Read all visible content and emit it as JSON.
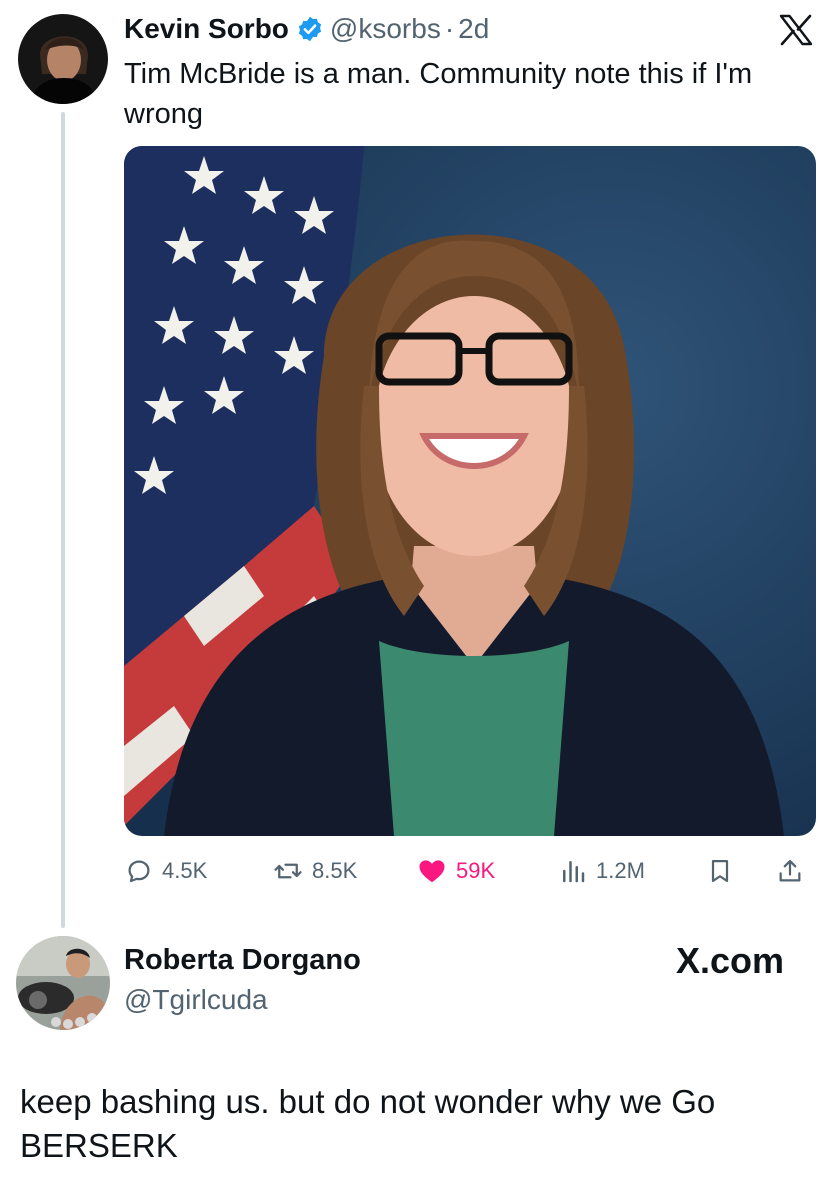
{
  "tweet": {
    "author_name": "Kevin Sorbo",
    "handle": "@ksorbs",
    "separator": "·",
    "age": "2d",
    "text": "Tim McBride is a man. Community note this if I'm wrong",
    "verified_icon": "verified-badge-icon",
    "platform_icon": "x-logo-icon",
    "stats": {
      "replies": "4.5K",
      "reposts": "8.5K",
      "likes": "59K",
      "views": "1.2M"
    }
  },
  "reply": {
    "author_name": "Roberta Dorgano",
    "handle": "@Tgirlcuda",
    "site_label": "X.com",
    "text": "keep bashing us. but do not wonder why we Go BERSERK"
  },
  "colors": {
    "text_primary": "#0f1419",
    "text_secondary": "#536471",
    "verified_blue": "#1d9bf0",
    "like_pink": "#f91880",
    "thread_line": "#cfd9de"
  }
}
